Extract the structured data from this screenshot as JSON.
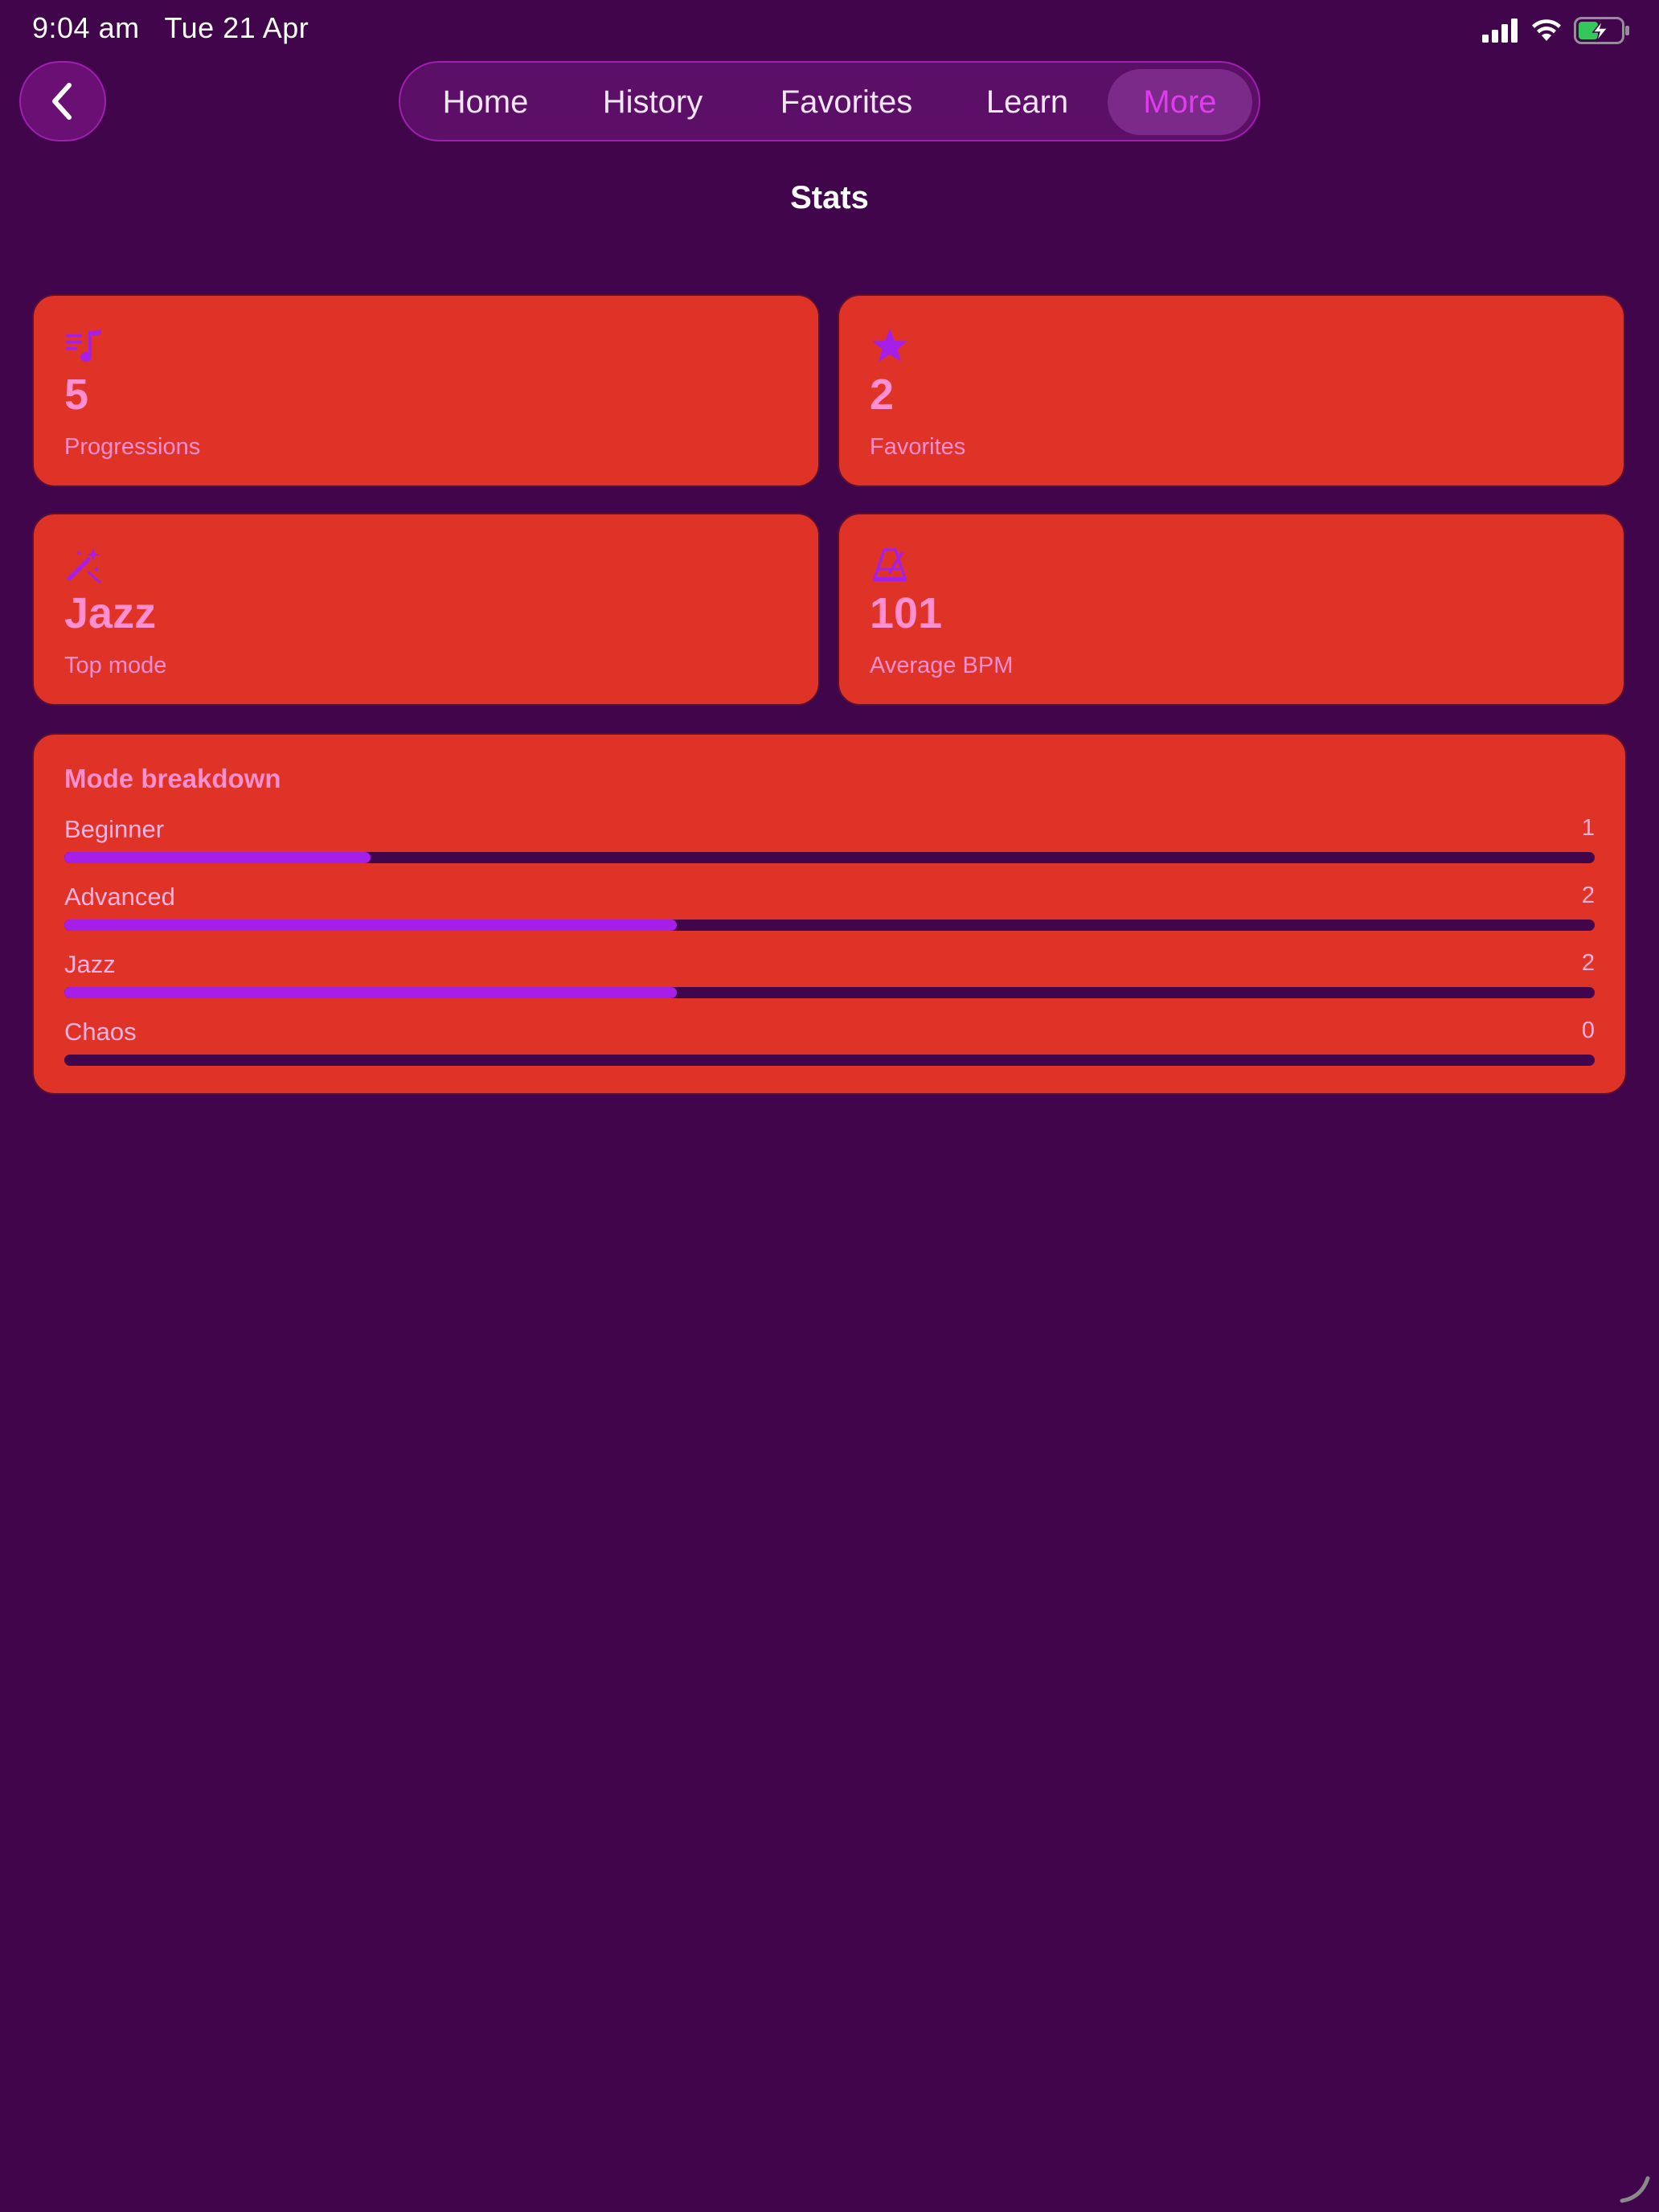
{
  "status_bar": {
    "time": "9:04 am",
    "date": "Tue 21 Apr"
  },
  "nav": {
    "tabs": [
      {
        "label": "Home",
        "active": false
      },
      {
        "label": "History",
        "active": false
      },
      {
        "label": "Favorites",
        "active": false
      },
      {
        "label": "Learn",
        "active": false
      },
      {
        "label": "More",
        "active": true
      }
    ]
  },
  "page": {
    "title": "Stats"
  },
  "stats": [
    {
      "icon": "playlist-music-icon",
      "value": "5",
      "label": "Progressions"
    },
    {
      "icon": "star-icon",
      "value": "2",
      "label": "Favorites"
    },
    {
      "icon": "magic-wand-icon",
      "value": "Jazz",
      "label": "Top mode"
    },
    {
      "icon": "metronome-icon",
      "value": "101",
      "label": "Average BPM"
    }
  ],
  "breakdown": {
    "title": "Mode breakdown",
    "max": 5,
    "modes": [
      {
        "name": "Beginner",
        "count": 1
      },
      {
        "name": "Advanced",
        "count": 2
      },
      {
        "name": "Jazz",
        "count": 2
      },
      {
        "name": "Chaos",
        "count": 0
      }
    ]
  },
  "colors": {
    "background": "#40054A",
    "card": "#E03327",
    "accent": "#A51FE8",
    "card_text": "#FF8FD0",
    "active_tab_text": "#E23AF0"
  }
}
